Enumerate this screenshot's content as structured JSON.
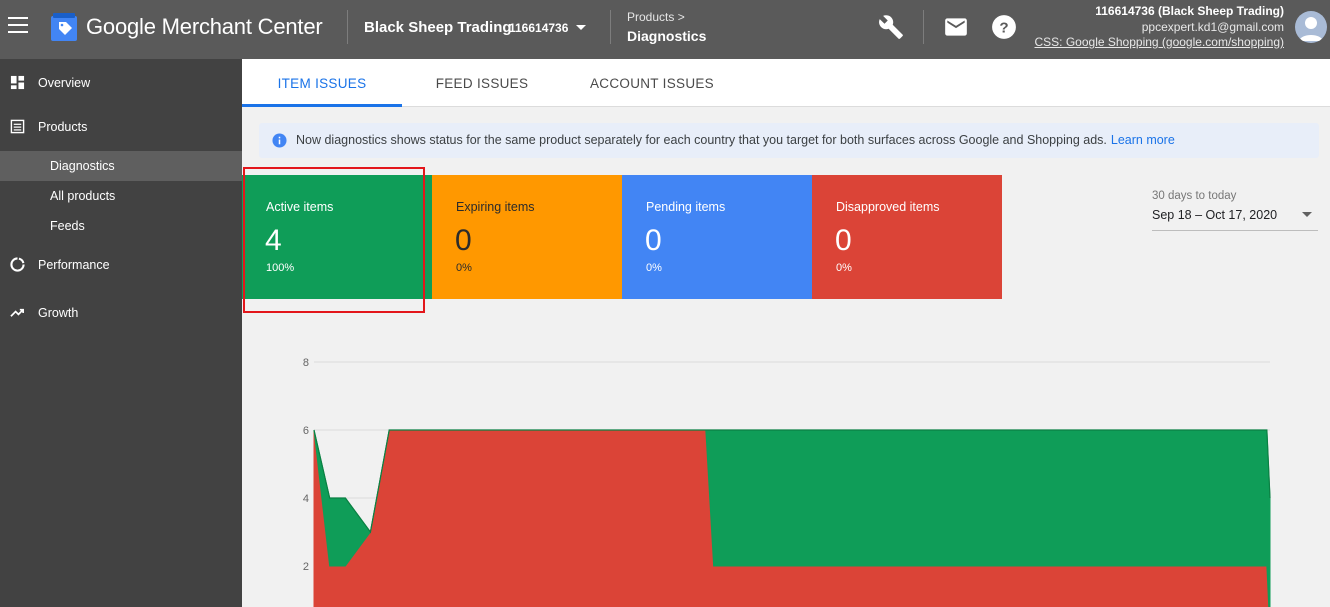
{
  "header": {
    "app_title": "Google Merchant Center",
    "account_name": "Black Sheep Trading",
    "account_id": "116614736",
    "breadcrumb_parent": "Products >",
    "breadcrumb_current": "Diagnostics",
    "icons": [
      "menu-icon",
      "wrench-icon",
      "mail-icon",
      "help-icon"
    ],
    "user_line1": "116614736 (Black Sheep Trading)",
    "user_line2": "ppcexpert.kd1@gmail.com",
    "user_line3": "CSS: Google Shopping (google.com/shopping)"
  },
  "sidebar": {
    "items": [
      {
        "label": "Overview",
        "icon": "overview-icon"
      },
      {
        "label": "Products",
        "icon": "products-icon"
      },
      {
        "label": "Diagnostics",
        "active": true
      },
      {
        "label": "All products"
      },
      {
        "label": "Feeds"
      },
      {
        "label": "Performance",
        "icon": "performance-icon"
      },
      {
        "label": "Growth",
        "icon": "growth-icon"
      }
    ]
  },
  "tabs": [
    {
      "label": "ITEM ISSUES",
      "active": true
    },
    {
      "label": "FEED ISSUES"
    },
    {
      "label": "ACCOUNT ISSUES"
    }
  ],
  "banner": {
    "text": "Now diagnostics shows status for the same product separately for each country that you target for both surfaces across Google and Shopping ads.",
    "link": "Learn more"
  },
  "cards": {
    "active": {
      "label": "Active items",
      "value": "4",
      "pct": "100%",
      "color": "#0f9d58"
    },
    "expiring": {
      "label": "Expiring items",
      "value": "0",
      "pct": "0%",
      "color": "#ff9800"
    },
    "pending": {
      "label": "Pending items",
      "value": "0",
      "pct": "0%",
      "color": "#4285f4"
    },
    "disapproved": {
      "label": "Disapproved items",
      "value": "0",
      "pct": "0%",
      "color": "#db4437"
    }
  },
  "date": {
    "hint": "30 days to today",
    "range": "Sep 18 – Oct 17, 2020"
  },
  "chart_data": {
    "type": "area",
    "y_ticks": [
      "8",
      "6",
      "4",
      "2"
    ],
    "ylim": [
      0,
      8
    ],
    "grid": true,
    "x": [
      0,
      0.5,
      1,
      1.8,
      2.4,
      3,
      12.5,
      12.75,
      30.4,
      30.5
    ],
    "series": [
      {
        "values": [
          6,
          2,
          2,
          3,
          6,
          6,
          6,
          2,
          2,
          0
        ],
        "color": "#db4437"
      },
      {
        "values": [
          0,
          2,
          2,
          0,
          0,
          0,
          0,
          4,
          4,
          4
        ],
        "color": "#0f9d58"
      }
    ],
    "xlim": [
      0,
      30.5
    ]
  }
}
